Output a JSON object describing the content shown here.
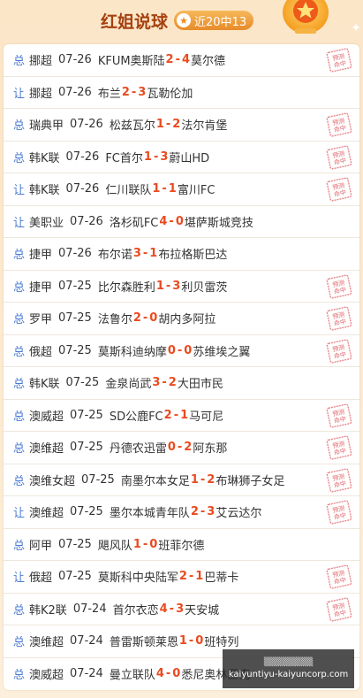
{
  "header": {
    "title": "红姐说球",
    "badge_icon": "star",
    "badge_label": "近20中13",
    "trophy_icon": "trophy-star-icon"
  },
  "rows": [
    {
      "tag": "总",
      "league": "挪超",
      "date": "07-26",
      "home": "KFUM奥斯陆",
      "h": "2",
      "sep": " - ",
      "a": "4",
      "away": "莫尔德",
      "stamp": true
    },
    {
      "tag": "让",
      "league": "挪超",
      "date": "07-26",
      "home": "布兰",
      "h": "2",
      "sep": " - ",
      "a": "3",
      "away": "瓦勒伦加",
      "stamp": false
    },
    {
      "tag": "总",
      "league": "瑞典甲",
      "date": "07-26",
      "home": "松兹瓦尔",
      "h": "1",
      "sep": " - ",
      "a": "2",
      "away": "法尔肯堡",
      "stamp": true
    },
    {
      "tag": "总",
      "league": "韩K联",
      "date": "07-26",
      "home": "FC首尔",
      "h": "1",
      "sep": " - ",
      "a": "3",
      "away": "蔚山HD",
      "stamp": true
    },
    {
      "tag": "让",
      "league": "韩K联",
      "date": "07-26",
      "home": "仁川联队",
      "h": "1",
      "sep": " - ",
      "a": "1",
      "away": "富川FC",
      "stamp": true
    },
    {
      "tag": "让",
      "league": "美职业",
      "date": "07-26",
      "home": "洛杉矶FC",
      "h": "4",
      "sep": " - ",
      "a": "0",
      "away": "堪萨斯城竞技",
      "stamp": false
    },
    {
      "tag": "总",
      "league": "捷甲",
      "date": "07-26",
      "home": "布尔诺",
      "h": "3",
      "sep": " - ",
      "a": "1",
      "away": "布拉格斯巴达",
      "stamp": false
    },
    {
      "tag": "总",
      "league": "捷甲",
      "date": "07-25",
      "home": "比尔森胜利",
      "h": "1",
      "sep": " - ",
      "a": "3",
      "away": "利贝雷茨",
      "stamp": true
    },
    {
      "tag": "总",
      "league": "罗甲",
      "date": "07-25",
      "home": "法鲁尔",
      "h": "2",
      "sep": " - ",
      "a": "0",
      "away": "胡内多阿拉",
      "stamp": true
    },
    {
      "tag": "总",
      "league": "俄超",
      "date": "07-25",
      "home": "莫斯科迪纳摩",
      "h": "0",
      "sep": " - ",
      "a": "0",
      "away": "苏维埃之翼",
      "stamp": true
    },
    {
      "tag": "总",
      "league": "韩K联",
      "date": "07-25",
      "home": "金泉尚武",
      "h": "3",
      "sep": " - ",
      "a": "2",
      "away": "大田市民",
      "stamp": false
    },
    {
      "tag": "总",
      "league": "澳威超",
      "date": "07-25",
      "home": "SD公鹿FC",
      "h": "2",
      "sep": " - ",
      "a": "1",
      "away": "马可尼",
      "stamp": true
    },
    {
      "tag": "总",
      "league": "澳维超",
      "date": "07-25",
      "home": "丹德农迅雷",
      "h": "0",
      "sep": " - ",
      "a": "2",
      "away": "阿东那",
      "stamp": true
    },
    {
      "tag": "总",
      "league": "澳维女超",
      "date": "07-25",
      "home": "南墨尔本女足",
      "h": "1",
      "sep": " - ",
      "a": "2",
      "away": "布琳狮子女足",
      "stamp": true
    },
    {
      "tag": "让",
      "league": "澳维超",
      "date": "07-25",
      "home": "墨尔本城青年队",
      "h": "2",
      "sep": " - ",
      "a": "3",
      "away": "艾云达尔",
      "stamp": true
    },
    {
      "tag": "总",
      "league": "阿甲",
      "date": "07-25",
      "home": "飓风队",
      "h": "1",
      "sep": " - ",
      "a": "0",
      "away": "班菲尔德",
      "stamp": false
    },
    {
      "tag": "让",
      "league": "俄超",
      "date": "07-25",
      "home": "莫斯科中央陆军",
      "h": "2",
      "sep": " - ",
      "a": "1",
      "away": "巴蒂卡",
      "stamp": true
    },
    {
      "tag": "总",
      "league": "韩K2联",
      "date": "07-24",
      "home": "首尔衣恋",
      "h": "4",
      "sep": " - ",
      "a": "3",
      "away": "天安城",
      "stamp": true
    },
    {
      "tag": "总",
      "league": "澳维超",
      "date": "07-24",
      "home": "普雷斯顿莱恩",
      "h": "1",
      "sep": " - ",
      "a": "0",
      "away": "班特列",
      "stamp": false
    },
    {
      "tag": "总",
      "league": "澳威超",
      "date": "07-24",
      "home": "曼立联队",
      "h": "4",
      "sep": " - ",
      "a": "0",
      "away": "悉尼奥林匹克",
      "stamp": false
    }
  ],
  "stamp_text_1": "预测",
  "stamp_text_2": "命中",
  "overlay": {
    "line1": "▒▒▒▒▒▒▒▒",
    "line2": "kaiyuntiyu-kaiyuncorp.com"
  }
}
